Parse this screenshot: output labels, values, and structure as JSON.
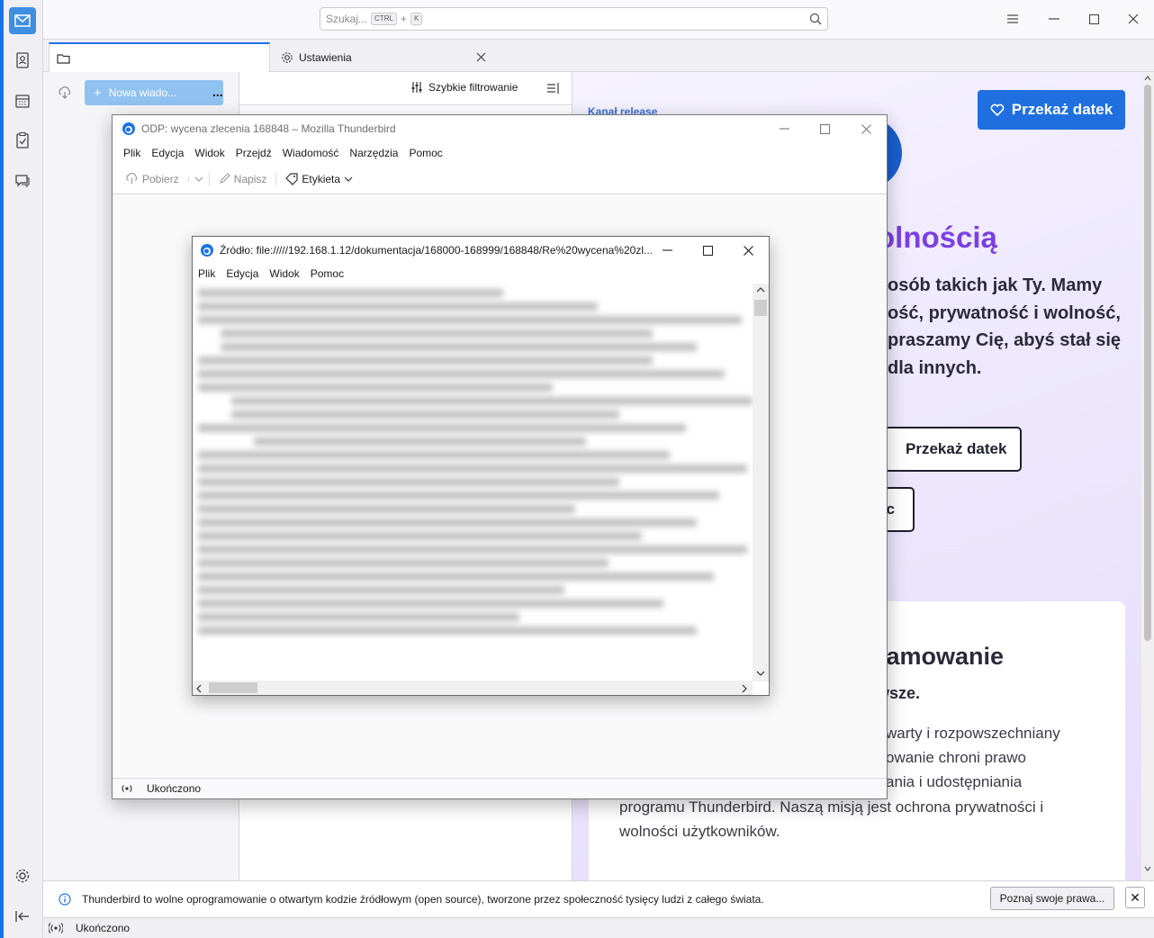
{
  "titlebar": {
    "search_placeholder": "Szukaj...",
    "shortcut_key1": "CTRL",
    "shortcut_plus": "+",
    "shortcut_key2": "K"
  },
  "tabs": [
    {
      "label": ""
    },
    {
      "label": "Ustawienia"
    }
  ],
  "folder_pane": {
    "new_message_label": "Nowa wiado...",
    "more_label": "..."
  },
  "thread_pane": {
    "quick_filter_label": "Szybkie filtrowanie"
  },
  "content": {
    "channel_label": "Kanał release",
    "donate_top_label": "Przekaż datek",
    "heading": "olnością",
    "intro_lines": [
      "osób takich jak Ty. Mamy",
      "ość, prywatność i wolność,",
      "praszamy Cię, abyś stał się",
      "dla innych."
    ],
    "donate_mid_label": "Przekaż datek",
    "second_button_label": "c",
    "card_heading": "ramowanie",
    "card_subheading": "awsze.",
    "card_right_lines": [
      "warty i rozpowszechniany",
      "owanie chroni prawo",
      "ania i udostępniania"
    ],
    "card_full_lines": [
      "programu Thunderbird. Naszą misją jest ochrona prywatności i",
      "wolności użytkowników."
    ]
  },
  "notification": {
    "text": "Thunderbird to wolne oprogramowanie o otwartym kodzie źródłowym (open source), tworzone przez społeczność tysięcy ludzi z całego świata.",
    "button_label": "Poznaj swoje prawa...",
    "close_label": "✕"
  },
  "statusbar": {
    "text": "Ukończono"
  },
  "message_window": {
    "title": "ODP: wycena zlecenia 168848 – Mozilla Thunderbird",
    "menu": [
      "Plik",
      "Edycja",
      "Widok",
      "Przejdź",
      "Wiadomość",
      "Narzędzia",
      "Pomoc"
    ],
    "toolbar": {
      "get_label": "Pobierz",
      "write_label": "Napisz",
      "tag_label": "Etykieta"
    },
    "status_text": "Ukończono"
  },
  "source_window": {
    "title": "Źródło: file://///192.168.1.12/dokumentacja/168000-168999/168848/Re%20wycena%20zl...",
    "menu": [
      "Plik",
      "Edycja",
      "Widok",
      "Pomoc"
    ]
  },
  "colors": {
    "accent": "#1a73e8",
    "donate_button": "#1f6fe0",
    "heading_purple": "#7b3fe4"
  }
}
